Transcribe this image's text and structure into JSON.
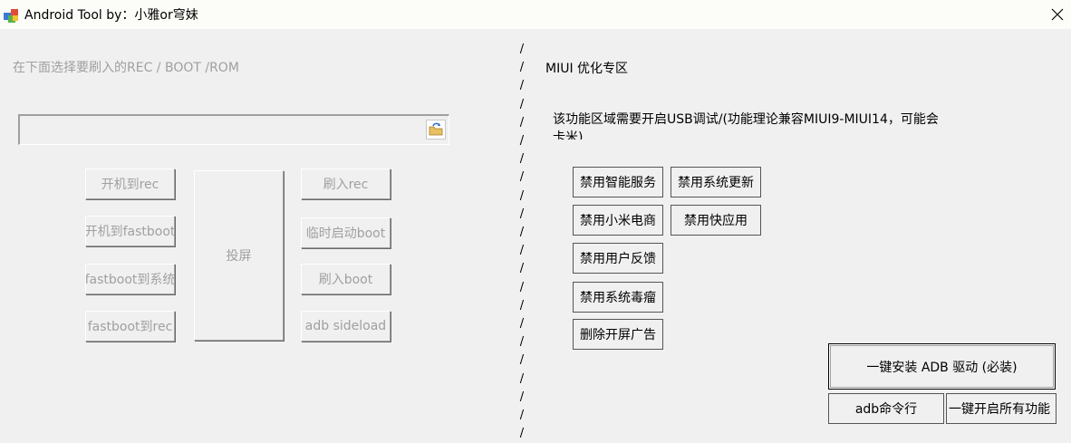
{
  "window": {
    "title": "Android Tool by：小雅or穹妹"
  },
  "left": {
    "instruction": "在下面选择要刷入的REC / BOOT /ROM",
    "file_input": {
      "value": "",
      "placeholder": ""
    },
    "buttons": {
      "boot_rec": "开机到rec",
      "boot_fastboot": "开机到fastboot",
      "fastboot_system": "fastboot到系统",
      "fastboot_rec": "fastboot到rec",
      "screen_cast": "投屏",
      "flash_rec": "刷入rec",
      "temp_boot": "临时启动boot",
      "flash_boot": "刷入boot",
      "adb_sideload": "adb sideload"
    }
  },
  "divider": {
    "char": "/",
    "count": 22
  },
  "right": {
    "section_title": "MIUI 优化专区",
    "notice_line1": "该功能区域需要开启USB调试/(功能理论兼容MIUI9-MIUI14，可能会",
    "notice_line2": "卡米)",
    "buttons": {
      "disable_smart_service": "禁用智能服务",
      "disable_system_update": "禁用系统更新",
      "disable_mi_store": "禁用小米电商",
      "disable_quick_apps": "禁用快应用",
      "disable_feedback": "禁用用户反馈",
      "disable_virus_scan": "禁用系统毒瘤",
      "remove_splash_ads": "删除开屏广告",
      "install_adb_driver": "一键安装 ADB 驱动 (必装)",
      "adb_cmd": "adb命令行",
      "enable_all": "一键开启所有功能"
    }
  },
  "colors": {
    "window_bg": "#f0f0f0",
    "titlebar_bg": "#fcfdf8",
    "disabled_text": "#a0a0a0"
  }
}
